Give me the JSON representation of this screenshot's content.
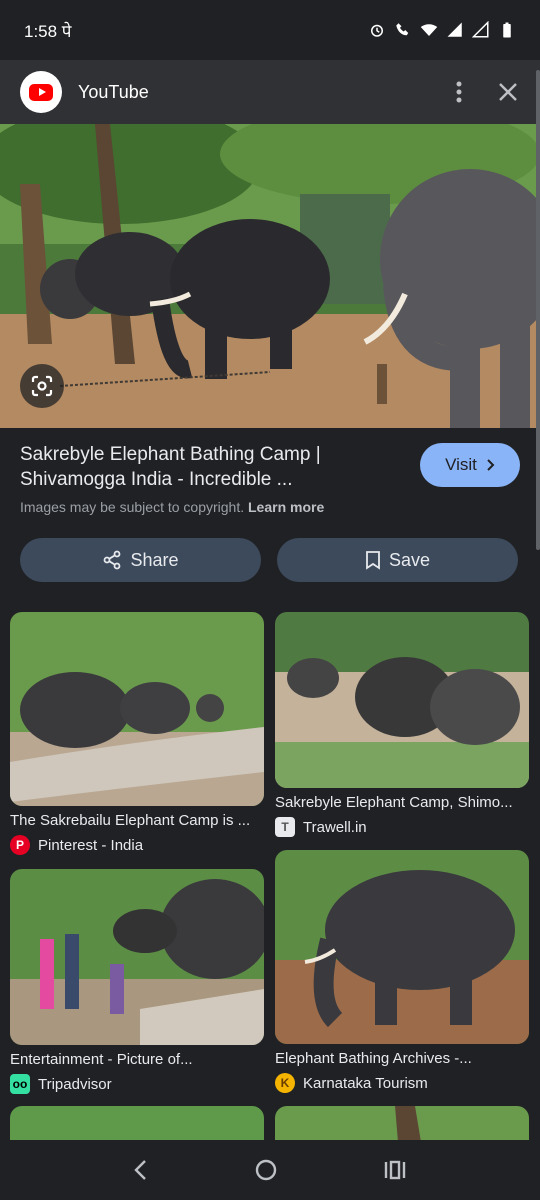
{
  "status_bar": {
    "time": "1:58 पे"
  },
  "header": {
    "app_title": "YouTube"
  },
  "result": {
    "title": "Sakrebyle Elephant Bathing Camp | Shivamogga India - Incredible ...",
    "visit_label": "Visit",
    "copyright_text": "Images may be subject to copyright.",
    "learn_more": "Learn more",
    "share_label": "Share",
    "save_label": "Save"
  },
  "related": [
    {
      "title": "The Sakrebailu Elephant Camp is ...",
      "source": "Pinterest - India",
      "icon": "pinterest-icon",
      "color": "#e60023"
    },
    {
      "title": "Sakrebyle Elephant Camp, Shimo...",
      "source": "Trawell.in",
      "icon": "trawell-icon",
      "color": "#e8eaed"
    },
    {
      "title": "Entertainment - Picture of...",
      "source": "Tripadvisor",
      "icon": "tripadvisor-icon",
      "color": "#34e0a1"
    },
    {
      "title": "Elephant Bathing Archives -...",
      "source": "Karnataka Tourism",
      "icon": "karnataka-tourism-icon",
      "color": "#f4b400"
    }
  ],
  "colors": {
    "accent": "#8ab4f8",
    "button_bg": "#3c4a5c",
    "background": "#202124",
    "header_bg": "#303134"
  }
}
